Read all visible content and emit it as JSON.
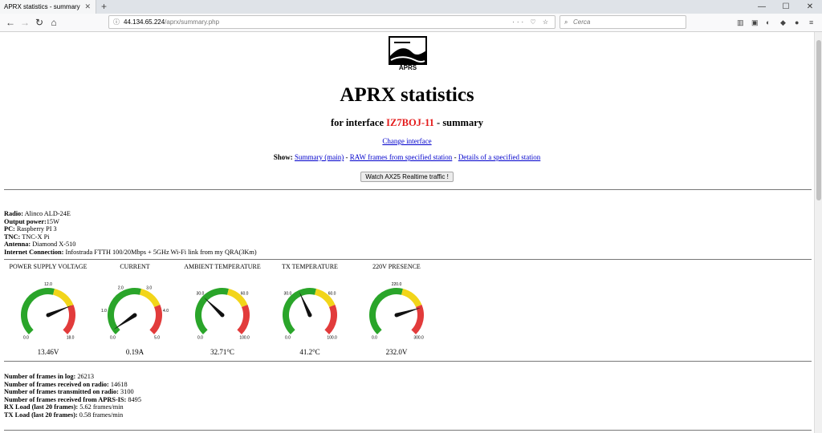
{
  "browser": {
    "tab_title": "APRX statistics - summary",
    "url_host": "44.134.65.224",
    "url_path": "/aprx/summary.php",
    "search_placeholder": "Cerca"
  },
  "header": {
    "logo_text": "APRS",
    "title": "APRX statistics",
    "sub_prefix": "for interface ",
    "callsign": "IZ7BOJ-11",
    "sub_suffix": " - summary",
    "change_link": "Change interface",
    "show_label": "Show:",
    "links": [
      "Summary (main)",
      "RAW frames from specified station",
      "Details of a specified station"
    ],
    "sep": " - ",
    "button": "Watch AX25 Realtime traffic !"
  },
  "station": [
    {
      "label": "Radio:",
      "value": " Alinco ALD-24E"
    },
    {
      "label": "Output power:",
      "value": "15W"
    },
    {
      "label": "PC:",
      "value": " Raspberry PI 3"
    },
    {
      "label": "TNC:",
      "value": " TNC-X Pi"
    },
    {
      "label": "Antenna:",
      "value": " Diamond X-510"
    },
    {
      "label": "Internet Connection:",
      "value": " Infostrada FTTH 100/20Mbps + 5GHz Wi-Fi link from my QRA(3Km)"
    }
  ],
  "gauges": [
    {
      "title": "POWER SUPPLY VOLTAGE",
      "value": "13.46V",
      "ticks": [
        "0.0",
        "12.0",
        "18.0"
      ],
      "needle": 0.75
    },
    {
      "title": "CURRENT",
      "value": "0.19A",
      "ticks": [
        "0.0",
        "1.0",
        "2.0",
        "3.0",
        "4.0",
        "5.0"
      ],
      "needle": 0.04
    },
    {
      "title": "AMBIENT TEMPERATURE",
      "value": "32.71°C",
      "ticks": [
        "0.0",
        "30.0",
        "60.0",
        "100.0"
      ],
      "needle": 0.33
    },
    {
      "title": "TX TEMPERATURE",
      "value": "41.2°C",
      "ticks": [
        "0.0",
        "30.0",
        "60.0",
        "100.0"
      ],
      "needle": 0.41
    },
    {
      "title": "220V PRESENCE",
      "value": "232.0V",
      "ticks": [
        "0.0",
        "220.0",
        "300.0"
      ],
      "needle": 0.77
    }
  ],
  "stats": [
    {
      "label": "Number of frames in log:",
      "value": " 26213"
    },
    {
      "label": "Number of frames received on radio:",
      "value": " 14618"
    },
    {
      "label": "Number of frames transmitted on radio:",
      "value": " 3100"
    },
    {
      "label": "Number of frames received from APRS-IS:",
      "value": " 8495"
    },
    {
      "label": "RX Load (last 20 frames):",
      "value": " 5.62 frames/min"
    },
    {
      "label": "TX Load (last 20 frames):",
      "value": " 0.58 frames/min"
    }
  ],
  "colors": {
    "green": "#2aa52a",
    "yellow": "#f2d51a",
    "red": "#e23b3b",
    "link": "#0000cc",
    "callsign": "#e41b1b"
  }
}
